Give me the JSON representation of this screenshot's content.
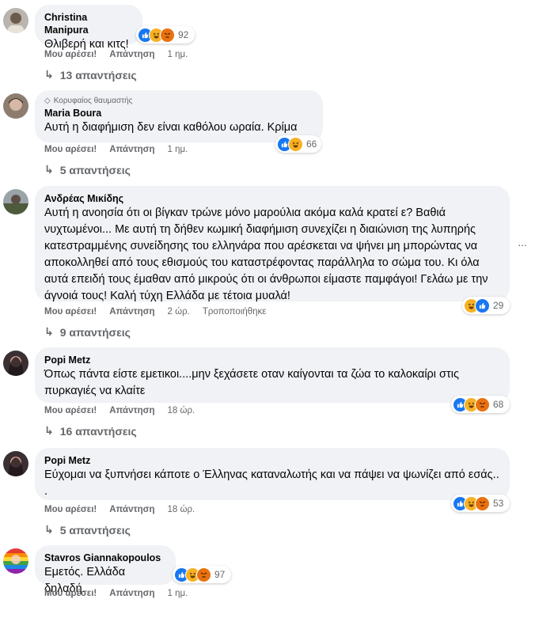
{
  "labels": {
    "like": "Μου αρέσει!",
    "reply": "Απάντηση"
  },
  "comments": [
    {
      "author": "Christina Manipura",
      "text": "Θλιβερή και κιτς!",
      "reaction_count": "92",
      "time": "1 ημ.",
      "replies": "13 απαντήσεις",
      "reactions": [
        "like-icon",
        "haha-icon",
        "angry-icon"
      ]
    },
    {
      "badge": "Κορυφαίος θαυμαστής",
      "author": "Maria Boura",
      "text": "Αυτή η διαφήμιση δεν είναι καθόλου ωραία. Κρίμα",
      "reaction_count": "66",
      "time": "1 ημ.",
      "replies": "5 απαντήσεις",
      "reactions": [
        "like-icon",
        "haha-icon"
      ]
    },
    {
      "author": "Ανδρέας Μικίδης",
      "text": "Αυτή η ανοησία ότι οι βίγκαν τρώνε μόνο μαρούλια ακόμα καλά κρατεί ε? Βαθιά νυχτωμένοι... Με αυτή τη δήθεν κωμική διαφήμιση συνεχίζει η διαιώνιση της λυπηρής κατεστραμμένης συνείδησης του ελληνάρα που αρέσκεται να ψήνει μη μπορώντας να αποκολληθεί από τους εθισμούς του καταστρέφοντας παράλληλα το σώμα του. Κι όλα αυτά επειδή τους έμαθαν από μικρούς ότι οι άνθρωποι είμαστε παμφάγοι! Γελάω με την άγνοιά τους! Καλή τύχη Ελλάδα με τέτοια μυαλά!",
      "reaction_count": "29",
      "time": "2 ώρ.",
      "edited": "Τροποποιήθηκε",
      "replies": "9 απαντήσεις",
      "reactions": [
        "haha-icon",
        "like-icon"
      ]
    },
    {
      "author": "Popi Metz",
      "text": "Όπως πάντα είστε εμετικοι....μην ξεχάσετε οταν καίγονται τα ζώα το καλοκαίρι στις πυρκαγιές να κλαίτε",
      "reaction_count": "68",
      "time": "18 ώρ.",
      "replies": "16 απαντήσεις",
      "reactions": [
        "like-icon",
        "haha-icon",
        "angry-icon"
      ]
    },
    {
      "author": "Popi Metz",
      "text": "Εύχομαι να ξυπνήσει κάποτε ο Έλληνας καταναλωτής και να πάψει να ψωνίζει από εσάς.. .",
      "reaction_count": "53",
      "time": "18 ώρ.",
      "replies": "5 απαντήσεις",
      "reactions": [
        "like-icon",
        "haha-icon",
        "angry-icon"
      ]
    },
    {
      "author": "Stavros Giannakopoulos",
      "text": "Εμετός. Ελλάδα δηλαδή.",
      "reaction_count": "97",
      "time": "1 ημ.",
      "reactions": [
        "like-icon",
        "haha-icon",
        "angry-icon"
      ]
    }
  ],
  "colors": {
    "like": "#1877f2",
    "haha": "#f7b125",
    "angry": "#e9710f",
    "bubble": "#f0f2f5",
    "meta": "#65676b"
  }
}
